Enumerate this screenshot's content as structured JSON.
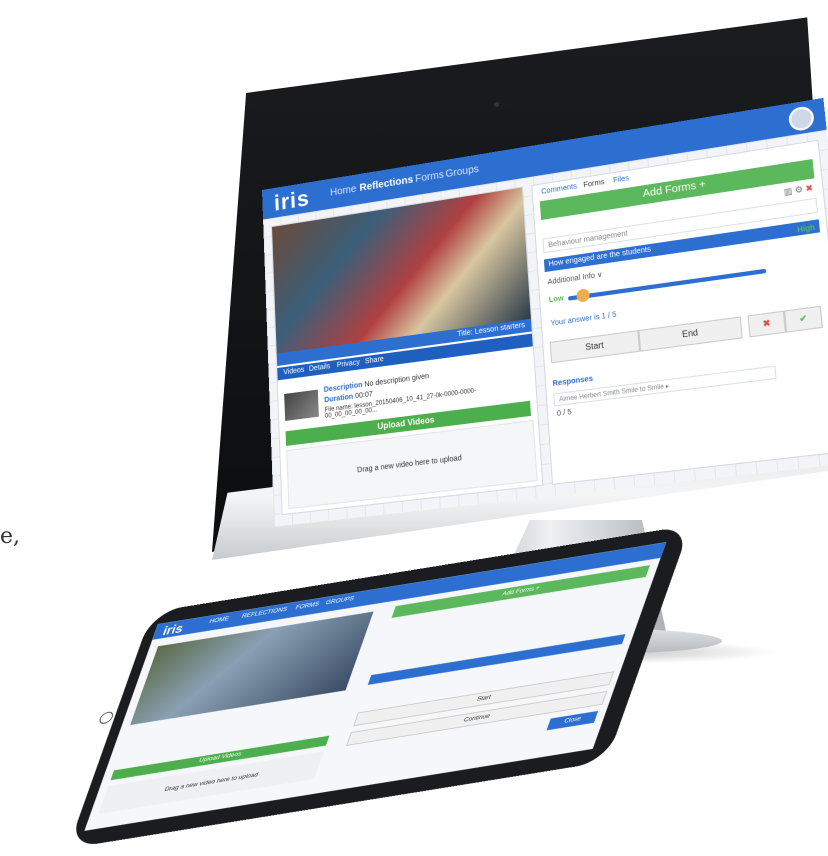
{
  "side_text": "e,",
  "imac": {
    "app": {
      "logo": "iris",
      "nav": [
        "Home",
        "Reflections",
        "Forms",
        "Groups"
      ],
      "active_nav": "Reflections",
      "video": {
        "title": "Title: Lesson starters",
        "tabs": [
          "Videos",
          "Details",
          "Privacy",
          "Share"
        ],
        "description_label": "Description",
        "description_value": "No description given",
        "duration_label": "Duration",
        "duration_value": "00:07",
        "filename": "File name: lesson_20150406_10_41_27-0k-0000-0000-00_00_00_00_00...",
        "upload_button": "Upload Videos",
        "drop_text": "Drag a new video here to upload"
      },
      "forms_panel": {
        "tabs": [
          "Comments",
          "Forms",
          "Files"
        ],
        "add_forms": "Add Forms +",
        "behaviour": "Behaviour management",
        "question": "How engaged are the students",
        "additional_info": "Additional Info ∨",
        "high_label": "High",
        "low_label": "Low",
        "answer_text": "Your answer is 1 / 5",
        "start_button": "Start",
        "end_button": "End",
        "responses_label": "Responses",
        "response_row": "Aimee Herbert Smith Smile to Smile ▸",
        "response_count": "0 / 5"
      }
    }
  },
  "ipad": {
    "logo": "iris",
    "nav": [
      "HOME",
      "REFLECTIONS",
      "FORMS",
      "GROUPS"
    ],
    "add_forms": "Add Forms +",
    "upload_button": "Upload Videos",
    "drop_text": "Drag a new video here to upload",
    "start_button": "Start",
    "end_button": "Continue",
    "close_button": "Close"
  }
}
